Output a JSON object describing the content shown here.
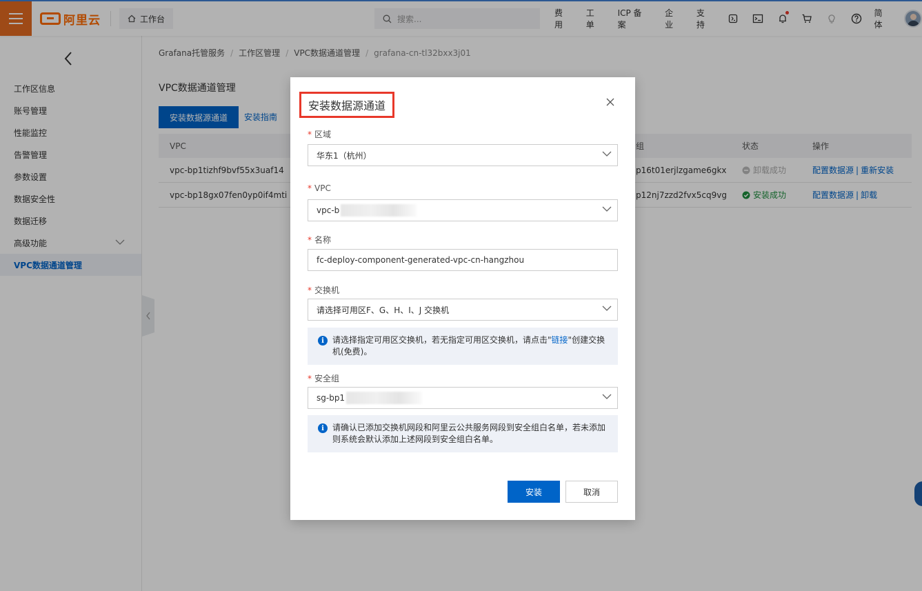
{
  "header": {
    "logo_text": "阿里云",
    "workbench_label": "工作台",
    "search_placeholder": "搜索...",
    "links": [
      "费用",
      "工单",
      "ICP 备案",
      "企业",
      "支持"
    ],
    "lang": "简体"
  },
  "sidebar": {
    "items": [
      {
        "label": "工作区信息"
      },
      {
        "label": "账号管理"
      },
      {
        "label": "性能监控"
      },
      {
        "label": "告警管理"
      },
      {
        "label": "参数设置"
      },
      {
        "label": "数据安全性"
      },
      {
        "label": "数据迁移"
      },
      {
        "label": "高级功能"
      },
      {
        "label": "VPC数据通道管理"
      }
    ]
  },
  "breadcrumb": [
    "Grafana托管服务",
    "工作区管理",
    "VPC数据通道管理",
    "grafana-cn-tl32bxx3j01"
  ],
  "main": {
    "title": "VPC数据通道管理",
    "install_button": "安装数据源通道",
    "guide_link": "安装指南",
    "columns": {
      "vpc": "VPC",
      "sg": "组",
      "status": "状态",
      "ops": "操作"
    },
    "rows": [
      {
        "vpc": "vpc-bp1tizhf9bvf55x3uaf14",
        "sg": "p16t01erjlzgame6gkx",
        "status": "卸载成功",
        "op1": "配置数据源",
        "op2": "重新安装"
      },
      {
        "vpc": "vpc-bp18gx07fen0yp0if4mti",
        "sg": "p12nj7zzd2fvx5cq9vg",
        "status": "安装成功",
        "op1": "配置数据源",
        "op2": "卸载"
      }
    ]
  },
  "dialog": {
    "title": "安装数据源通道",
    "region_label": "区域",
    "region_value": "华东1（杭州）",
    "vpc_label": "VPC",
    "vpc_value": "vpc-b",
    "name_label": "名称",
    "name_value": "fc-deploy-component-generated-vpc-cn-hangzhou",
    "switch_label": "交换机",
    "switch_placeholder": "请选择可用区F、G、H、I、J 交换机",
    "switch_notice_1": "请选择指定可用区交换机，若无指定可用区交换机，请点击\"",
    "switch_notice_link": "链接",
    "switch_notice_2": "\"创建交换机(免费)。",
    "sg_label": "安全组",
    "sg_value": "sg-bp1",
    "sg_notice": "请确认已添加交换机网段和阿里云公共服务网段到安全组白名单，若未添加则系统会默认添加上述网段到安全组白名单。",
    "install_button": "安装",
    "cancel_button": "取消"
  }
}
